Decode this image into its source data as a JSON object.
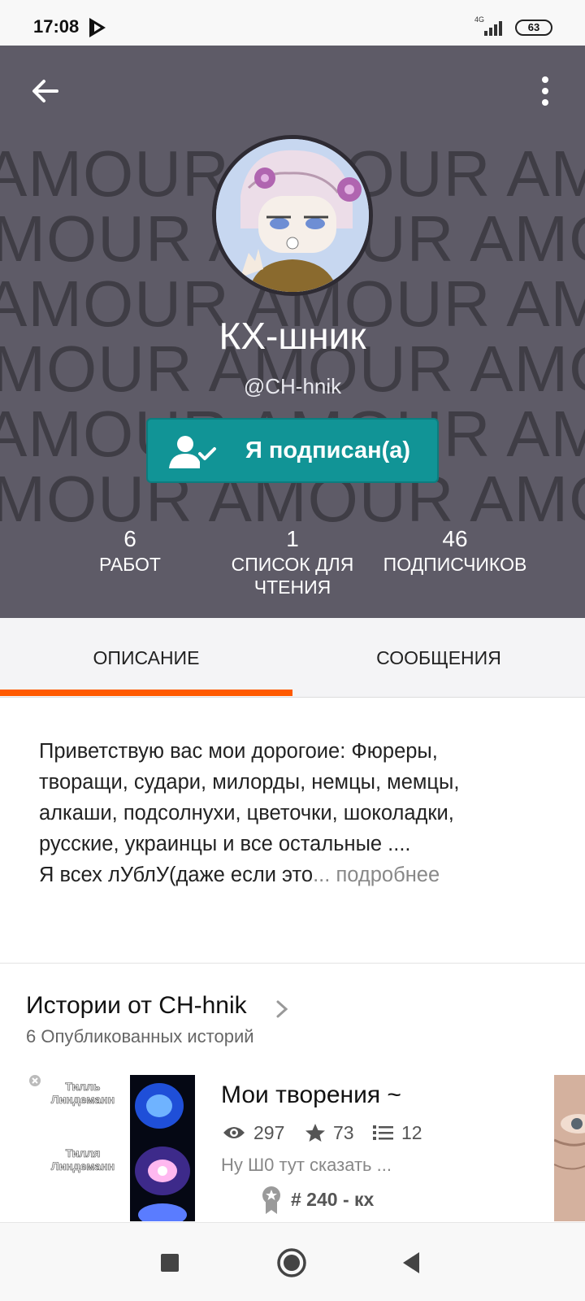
{
  "status_bar": {
    "time": "17:08",
    "network": "4G",
    "battery": "63"
  },
  "header": {
    "background_text": "AMOUR",
    "display_name": "КХ-шник",
    "username": "@CH-hnik",
    "follow_button_label": "Я подписан(а)",
    "stats": [
      {
        "value": "6",
        "label": "РАБОТ"
      },
      {
        "value": "1",
        "label_line1": "СПИСОК ДЛЯ",
        "label_line2": "ЧТЕНИЯ"
      },
      {
        "value": "46",
        "label": "ПОДПИСЧИКОВ"
      }
    ]
  },
  "tabs": [
    {
      "label": "ОПИСАНИЕ",
      "active": true
    },
    {
      "label": "СООБЩЕНИЯ",
      "active": false
    }
  ],
  "description": {
    "lines": [
      "Приветствую вас мои дорогоие: Фюреры,",
      "творащи, судари, милорды, немцы, мемцы,",
      "алкаши, подсолнухи, цветочки, шоколадки,",
      "русские, украинцы и все остальные ....",
      "Я всех лУблУ(даже если это"
    ],
    "ellipsis": "...",
    "more_link": "подробнее"
  },
  "stories": {
    "title": "Истории от CH-hnik",
    "subtitle": "6 Опубликованных историй",
    "items": [
      {
        "cover_text_top": "Тилль Линдеманн",
        "cover_text_bottom": "Тилля Линдеманн",
        "title": "Мои творения ~",
        "views": "297",
        "votes": "73",
        "parts": "12",
        "blurb": "Ну Ш0 тут сказать ...",
        "rank": "# 240 - кх"
      }
    ]
  },
  "colors": {
    "header_bg": "#5e5b67",
    "follow_button": "#119496",
    "tab_indicator": "#ff5a00"
  }
}
